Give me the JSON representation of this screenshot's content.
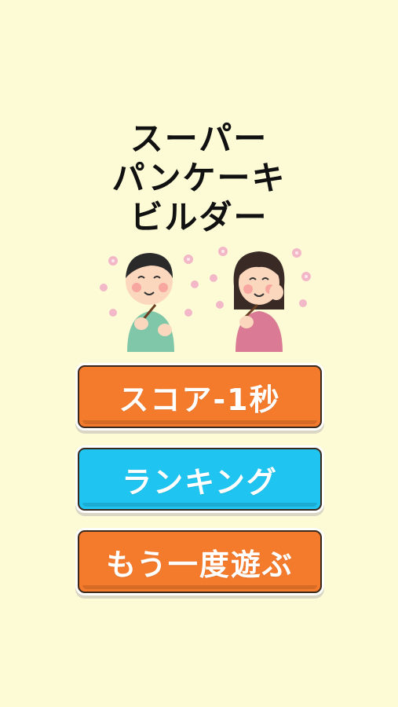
{
  "title": {
    "line1": "スーパー",
    "line2": "パンケーキ",
    "line3": "ビルダー"
  },
  "buttons": {
    "score_label": "スコア-1秒",
    "ranking_label": "ランキング",
    "replay_label": "もう一度遊ぶ"
  },
  "colors": {
    "background": "#fdfbd6",
    "orange_button": "#f47a2c",
    "blue_button": "#1fc4f1"
  },
  "illustration": {
    "icon": "couple-eating-pancake-icon"
  }
}
